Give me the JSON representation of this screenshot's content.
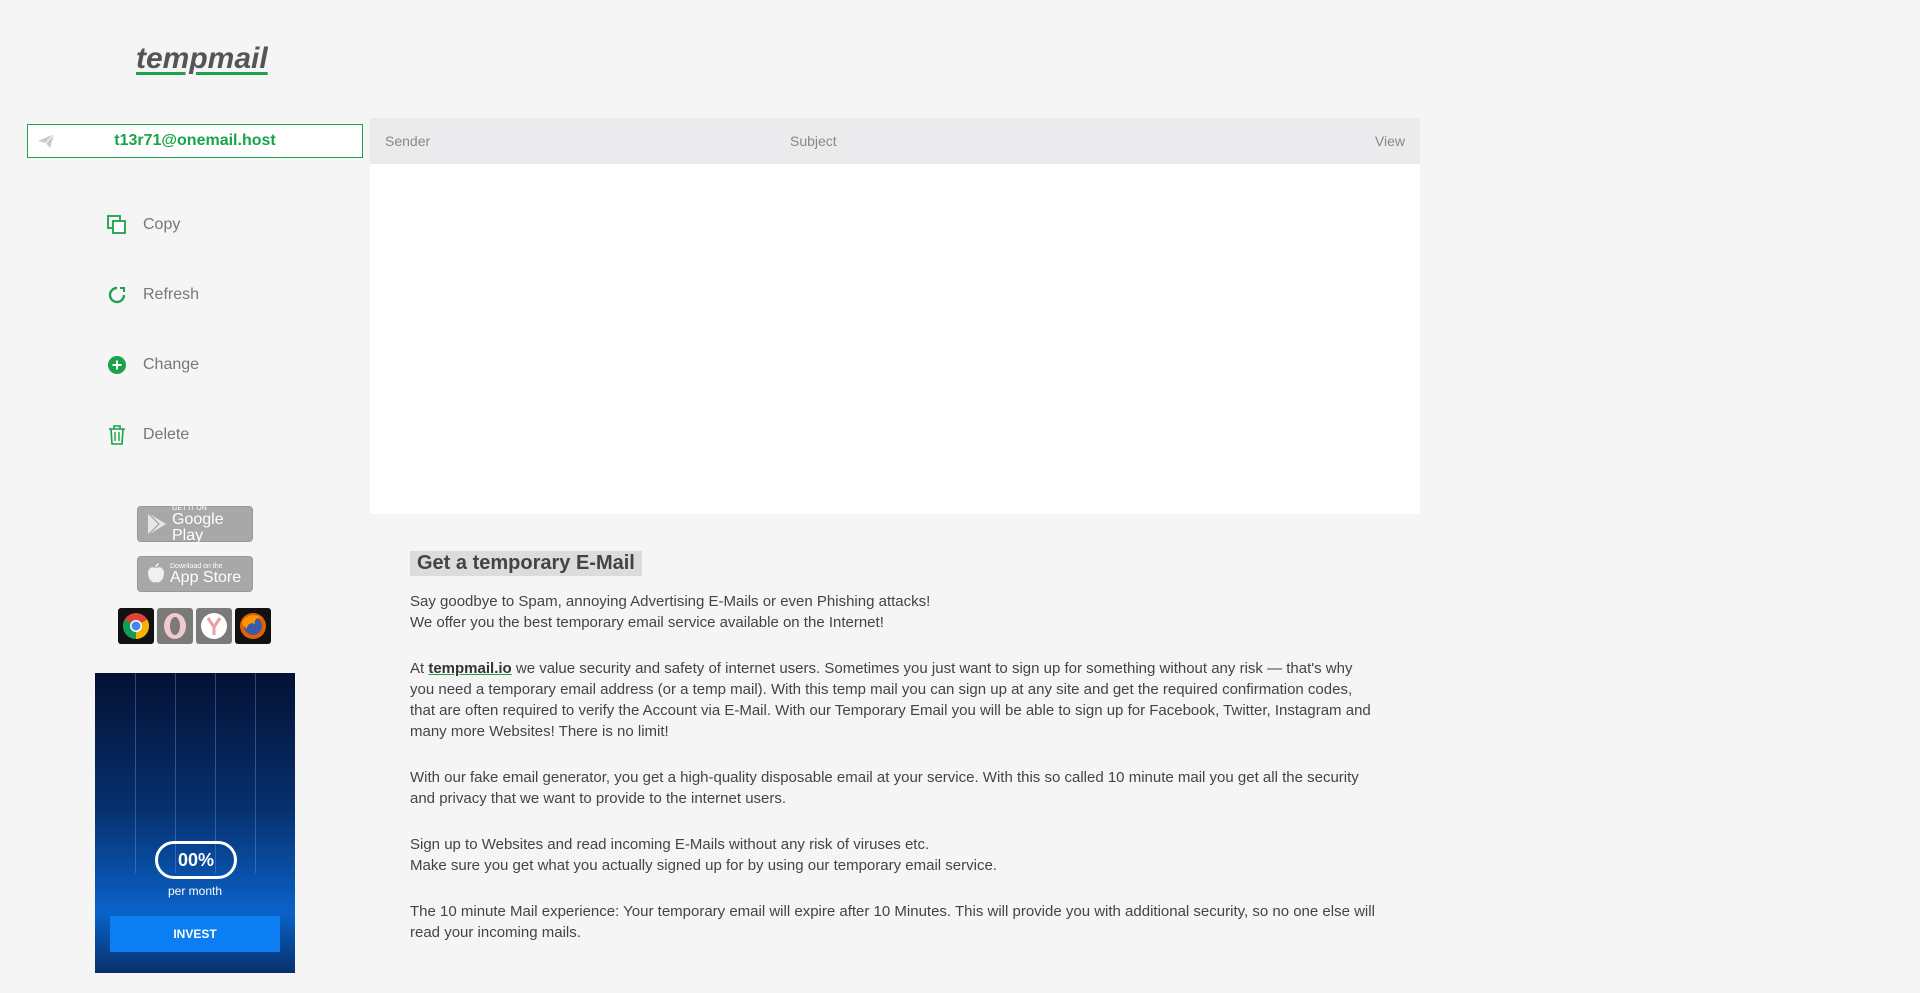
{
  "brand": {
    "logo": "tempmail"
  },
  "email": {
    "address": "t13r71@onemail.host"
  },
  "actions": [
    {
      "label": "Copy",
      "icon": "copy-icon"
    },
    {
      "label": "Refresh",
      "icon": "refresh-icon"
    },
    {
      "label": "Change",
      "icon": "plus-circle-icon"
    },
    {
      "label": "Delete",
      "icon": "trash-icon"
    }
  ],
  "inbox": {
    "columns": {
      "sender": "Sender",
      "subject": "Subject",
      "view": "View"
    }
  },
  "stores": {
    "google": {
      "small": "GET IT ON",
      "big": "Google Play"
    },
    "apple": {
      "small": "Download on the",
      "big": "App Store"
    }
  },
  "ad": {
    "rate": "00%",
    "period": "per month",
    "cta": "INVEST"
  },
  "content": {
    "heading": "Get a temporary E-Mail",
    "p1_line1": "Say goodbye to Spam, annoying Advertising E-Mails or even Phishing attacks!",
    "p1_line2": "We offer you the best temporary email service available on the Internet!",
    "p2_prefix": "At ",
    "p2_brand": "tempmail.io",
    "p2_rest": " we value security and safety of internet users. Sometimes you just want to sign up for something without any risk — that's why you need a temporary email address (or a temp mail). With this temp mail you can sign up at any site and get the required confirmation codes, that are often required to verify the Account via E-Mail. With our Temporary Email you will be able to sign up for Facebook, Twitter, Instagram and many more Websites! There is no limit!",
    "p3": "With our fake email generator, you get a high-quality disposable email at your service. With this so called 10 minute mail you get all the security and privacy that we want to provide to the internet users.",
    "p4_line1": "Sign up to Websites and read incoming E-Mails without any risk of viruses etc.",
    "p4_line2": "Make sure you get what you actually signed up for by using our temporary email service.",
    "p5": "The 10 minute Mail experience: Your temporary email will expire after 10 Minutes. This will provide you with additional security, so no one else will read your incoming mails."
  },
  "colors": {
    "accent": "#1aa34a",
    "invest": "#0a7ef2"
  }
}
